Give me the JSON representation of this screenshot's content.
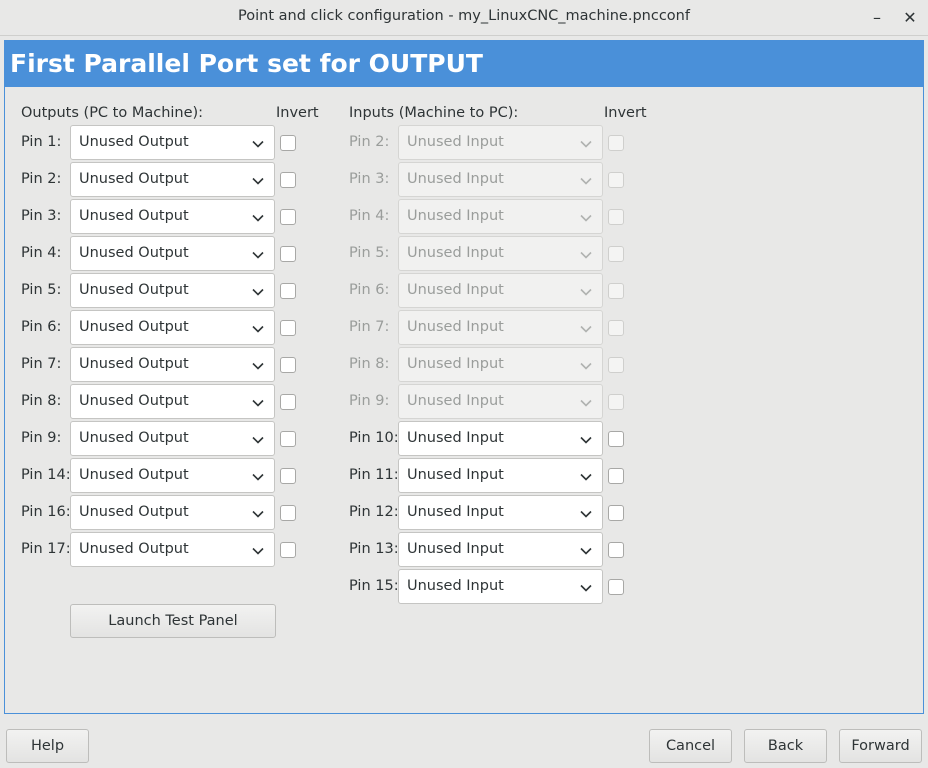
{
  "window": {
    "title": "Point and click configuration - my_LinuxCNC_machine.pncconf",
    "minimize_glyph": "–",
    "close_glyph": "✕"
  },
  "header": {
    "title": "First Parallel Port set for OUTPUT"
  },
  "outputs": {
    "heading": "Outputs (PC to Machine):",
    "invert_heading": "Invert",
    "rows": [
      {
        "pin": "Pin 1:",
        "value": "Unused Output"
      },
      {
        "pin": "Pin 2:",
        "value": "Unused Output"
      },
      {
        "pin": "Pin 3:",
        "value": "Unused Output"
      },
      {
        "pin": "Pin 4:",
        "value": "Unused Output"
      },
      {
        "pin": "Pin 5:",
        "value": "Unused Output"
      },
      {
        "pin": "Pin 6:",
        "value": "Unused Output"
      },
      {
        "pin": "Pin 7:",
        "value": "Unused Output"
      },
      {
        "pin": "Pin 8:",
        "value": "Unused Output"
      },
      {
        "pin": "Pin 9:",
        "value": "Unused Output"
      },
      {
        "pin": "Pin 14:",
        "value": "Unused Output"
      },
      {
        "pin": "Pin 16:",
        "value": "Unused Output"
      },
      {
        "pin": "Pin 17:",
        "value": "Unused Output"
      }
    ]
  },
  "inputs": {
    "heading": "Inputs (Machine to PC):",
    "invert_heading": "Invert",
    "rows": [
      {
        "pin": "Pin 2:",
        "value": "Unused Input",
        "enabled": false
      },
      {
        "pin": "Pin 3:",
        "value": "Unused Input",
        "enabled": false
      },
      {
        "pin": "Pin 4:",
        "value": "Unused Input",
        "enabled": false
      },
      {
        "pin": "Pin 5:",
        "value": "Unused Input",
        "enabled": false
      },
      {
        "pin": "Pin 6:",
        "value": "Unused Input",
        "enabled": false
      },
      {
        "pin": "Pin 7:",
        "value": "Unused Input",
        "enabled": false
      },
      {
        "pin": "Pin 8:",
        "value": "Unused Input",
        "enabled": false
      },
      {
        "pin": "Pin 9:",
        "value": "Unused Input",
        "enabled": false
      },
      {
        "pin": "Pin 10:",
        "value": "Unused Input",
        "enabled": true
      },
      {
        "pin": "Pin 11:",
        "value": "Unused Input",
        "enabled": true
      },
      {
        "pin": "Pin 12:",
        "value": "Unused Input",
        "enabled": true
      },
      {
        "pin": "Pin 13:",
        "value": "Unused Input",
        "enabled": true
      },
      {
        "pin": "Pin 15:",
        "value": "Unused Input",
        "enabled": true
      }
    ]
  },
  "test_panel_button": "Launch Test Panel",
  "footer": {
    "help": "Help",
    "cancel": "Cancel",
    "back": "Back",
    "forward": "Forward"
  }
}
